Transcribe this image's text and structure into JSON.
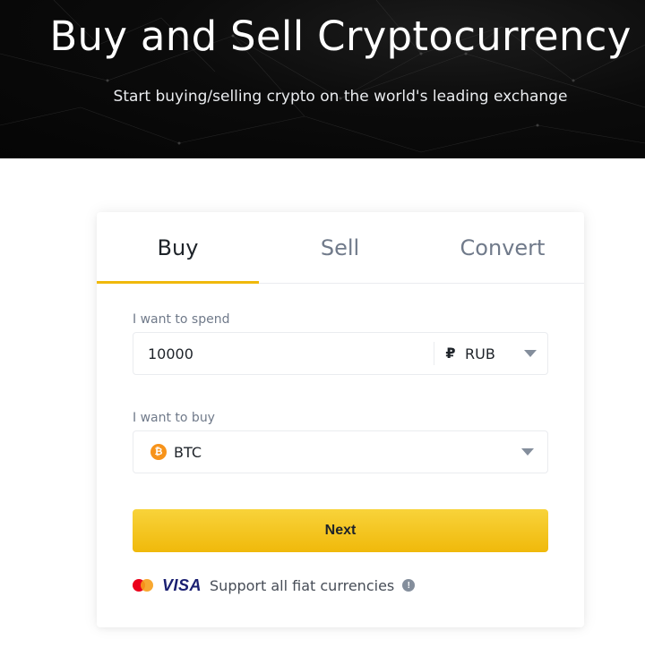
{
  "hero": {
    "title": "Buy and Sell Cryptocurrency",
    "subtitle": "Start buying/selling crypto on the world's leading exchange"
  },
  "tabs": [
    {
      "label": "Buy",
      "active": true
    },
    {
      "label": "Sell",
      "active": false
    },
    {
      "label": "Convert",
      "active": false
    }
  ],
  "spend": {
    "label": "I want to spend",
    "value": "10000",
    "currency_symbol": "₽",
    "currency": "RUB"
  },
  "buy": {
    "label": "I want to buy",
    "coin": "BTC",
    "coin_symbol": "₿"
  },
  "next_label": "Next",
  "support": {
    "visa_label": "VISA",
    "text": "Support all fiat currencies",
    "info_symbol": "!"
  },
  "colors": {
    "accent": "#f0b90b",
    "btc": "#f7931a",
    "text_primary": "#1e2329",
    "text_secondary": "#707a8a"
  }
}
